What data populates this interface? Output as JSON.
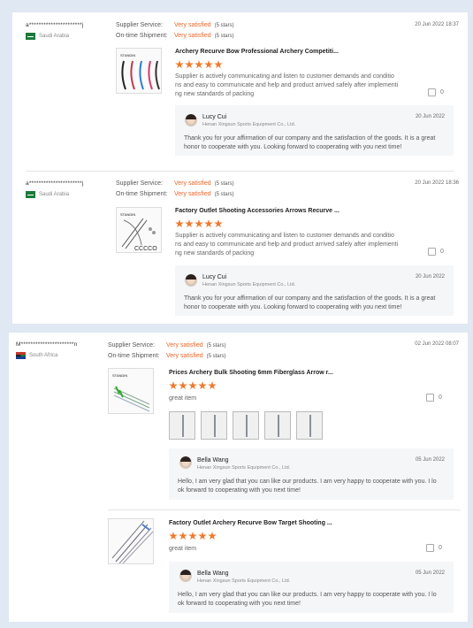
{
  "labels": {
    "supplier_service": "Supplier Service:",
    "on_time_shipment": "On-time Shipment:",
    "very_satisfied": "Very satisfied",
    "five_stars": "(5 stars)"
  },
  "colors": {
    "accent": "#ef7a2d",
    "satisfied": "#e8682b",
    "background": "#dfe8f3"
  },
  "reviews": [
    {
      "user": "a**********************j",
      "country": "Saudi Arabia",
      "date": "20 Jun 2022 18:37",
      "product": "Archery Recurve Bow Professional Archery Competiti...",
      "rating": 5,
      "text_lines": [
        "Supplier is actively communicating and listen to customer demands and conditio",
        "ns and easy to communicate and help and product arrived safely after implementi",
        "ng new standards of packing"
      ],
      "likes": "0",
      "reply": {
        "name": "Lucy Cui",
        "company": "Henan Xingsun Sports Equipment Co., Ltd.",
        "date": "20 Jun 2022",
        "lines": [
          "Thank you for your affirmation of our company and the satisfaction of the goods. It is a great",
          "honor to cooperate with you. Looking forward to cooperating with you next time!"
        ]
      }
    },
    {
      "user": "a**********************j",
      "country": "Saudi Arabia",
      "date": "20 Jun 2022 18:36",
      "product": "Factory Outlet Shooting Accessories Arrows Recurve ...",
      "rating": 5,
      "text_lines": [
        "Supplier is actively communicating and listen to customer demands and conditio",
        "ns and easy to communicate and help and product arrived safely after implementi",
        "ng new standards of packing"
      ],
      "likes": "0",
      "reply": {
        "name": "Lucy Cui",
        "company": "Henan Xingsun Sports Equipment Co., Ltd.",
        "date": "20 Jun 2022",
        "lines": [
          "Thank you for your affirmation of our company and the satisfaction of the goods. It is a great",
          "honor to cooperate with you. Looking forward to cooperating with you next time!"
        ]
      }
    },
    {
      "user": "M**********************n",
      "country": "South Africa",
      "date": "02 Jun 2022 08:07",
      "items": [
        {
          "product": "Prices Archery Bulk Shooting 6mm Fiberglass Arrow r...",
          "rating": 5,
          "text": "great item",
          "likes": "0",
          "reply": {
            "name": "Bella Wang",
            "company": "Henan Xingsun Sports Equipment Co., Ltd.",
            "date": "05 Jun 2022",
            "lines": [
              "Hello, I am very glad that you can like our products. I am very happy to cooperate with you. I lo",
              "ok forward to cooperating with you next time!"
            ]
          }
        },
        {
          "product": "Factory Outlet Archery Recurve Bow Target Shooting ...",
          "rating": 5,
          "text": "great item",
          "likes": "0",
          "reply": {
            "name": "Bella Wang",
            "company": "Henan Xingsun Sports Equipment Co., Ltd.",
            "date": "05 Jun 2022",
            "lines": [
              "Hello, I am very glad that you can like our products. I am very happy to cooperate with you. I lo",
              "ok forward to cooperating with you next time!"
            ]
          }
        }
      ]
    }
  ]
}
